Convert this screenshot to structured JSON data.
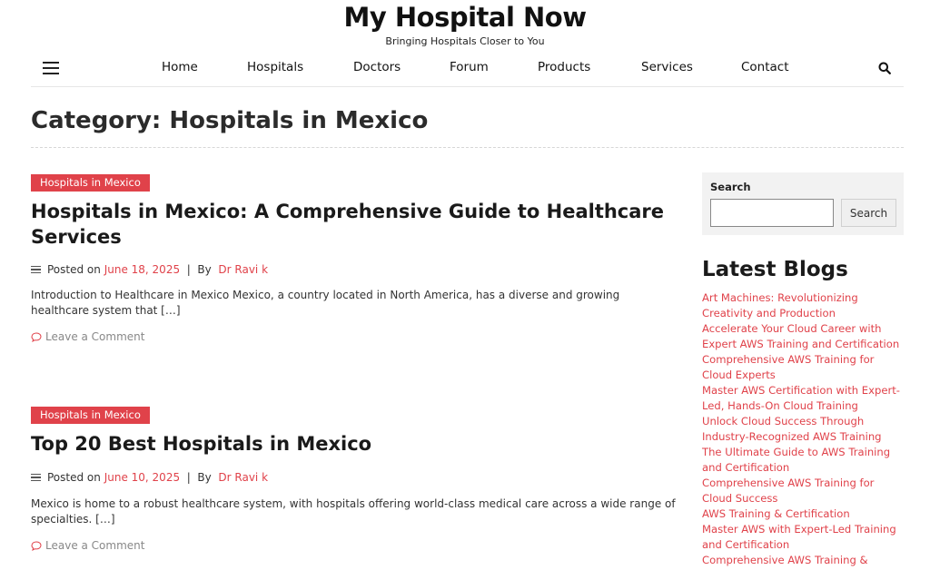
{
  "site": {
    "title": "My Hospital Now",
    "tagline": "Bringing Hospitals Closer to You"
  },
  "nav": {
    "items": [
      "Home",
      "Hospitals",
      "Doctors",
      "Forum",
      "Products",
      "Services",
      "Contact"
    ],
    "menu_icon": "hamburger-menu-icon",
    "search_icon": "search-icon"
  },
  "archive": {
    "title": "Category: Hospitals in Mexico"
  },
  "posts": [
    {
      "category": "Hospitals in Mexico",
      "title": "Hospitals in Mexico: A Comprehensive Guide to Healthcare Services",
      "posted_on": "Posted on",
      "date": "June 18, 2025",
      "separator": "|",
      "by": "By",
      "author": "Dr Ravi k",
      "excerpt": "Introduction to Healthcare in Mexico Mexico, a country located in North America, has a diverse and growing healthcare system that […]",
      "comment": "Leave a Comment"
    },
    {
      "category": "Hospitals in Mexico",
      "title": "Top 20 Best Hospitals in Mexico",
      "posted_on": "Posted on",
      "date": "June 10, 2025",
      "separator": "|",
      "by": "By",
      "author": "Dr Ravi k",
      "excerpt": "Mexico is home to a robust healthcare system, with hospitals offering world-class medical care across a wide range of specialties. […]",
      "comment": "Leave a Comment"
    }
  ],
  "sidebar": {
    "search": {
      "label": "Search",
      "placeholder": "",
      "value": "",
      "button": "Search"
    },
    "latest": {
      "title": "Latest Blogs",
      "items": [
        "Art Machines: Revolutionizing Creativity and Production",
        "Accelerate Your Cloud Career with Expert AWS Training and Certification",
        "Comprehensive AWS Training for Cloud Experts",
        "Master AWS Certification with Expert-Led, Hands-On Cloud Training",
        "Unlock Cloud Success Through Industry-Recognized AWS Training",
        "The Ultimate Guide to AWS Training and Certification",
        "Comprehensive AWS Training for Cloud Success",
        "AWS Training & Certification",
        "Master AWS with Expert-Led Training and Certification",
        "Comprehensive AWS Training & Certification for Cloud Success"
      ]
    }
  },
  "colors": {
    "accent": "#e0424a",
    "sidebar_bg": "#f2f2f2",
    "text": "#1a1a1a"
  }
}
